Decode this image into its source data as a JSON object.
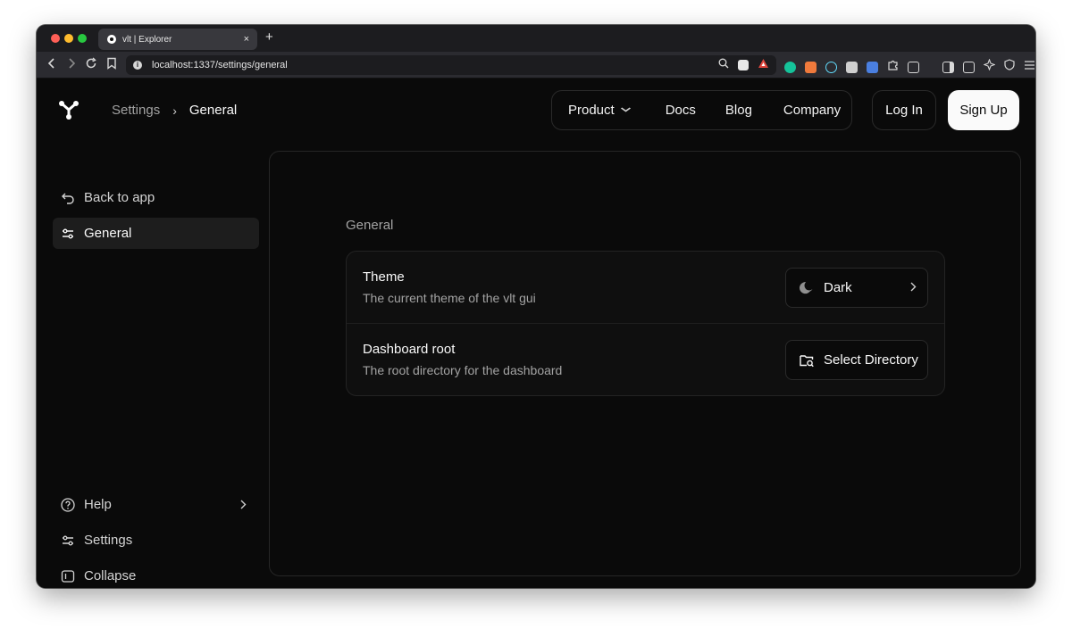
{
  "browser": {
    "tab_title": "vlt | Explorer",
    "tab_close": "×",
    "new_tab": "+",
    "url": "localhost:1337/settings/general"
  },
  "header": {
    "breadcrumb_parent": "Settings",
    "breadcrumb_separator": "›",
    "breadcrumb_current": "General",
    "nav": {
      "product": "Product",
      "docs": "Docs",
      "blog": "Blog",
      "company": "Company"
    },
    "login_label": "Log In",
    "signup_label": "Sign Up"
  },
  "sidebar": {
    "back": "Back to app",
    "general": "General",
    "help": "Help",
    "settings": "Settings",
    "collapse": "Collapse"
  },
  "main": {
    "section_title": "General",
    "theme": {
      "title": "Theme",
      "description": "The current theme of the vlt gui",
      "value": "Dark"
    },
    "dashboard_root": {
      "title": "Dashboard root",
      "description": "The root directory for the dashboard",
      "button_label": "Select Directory"
    }
  }
}
